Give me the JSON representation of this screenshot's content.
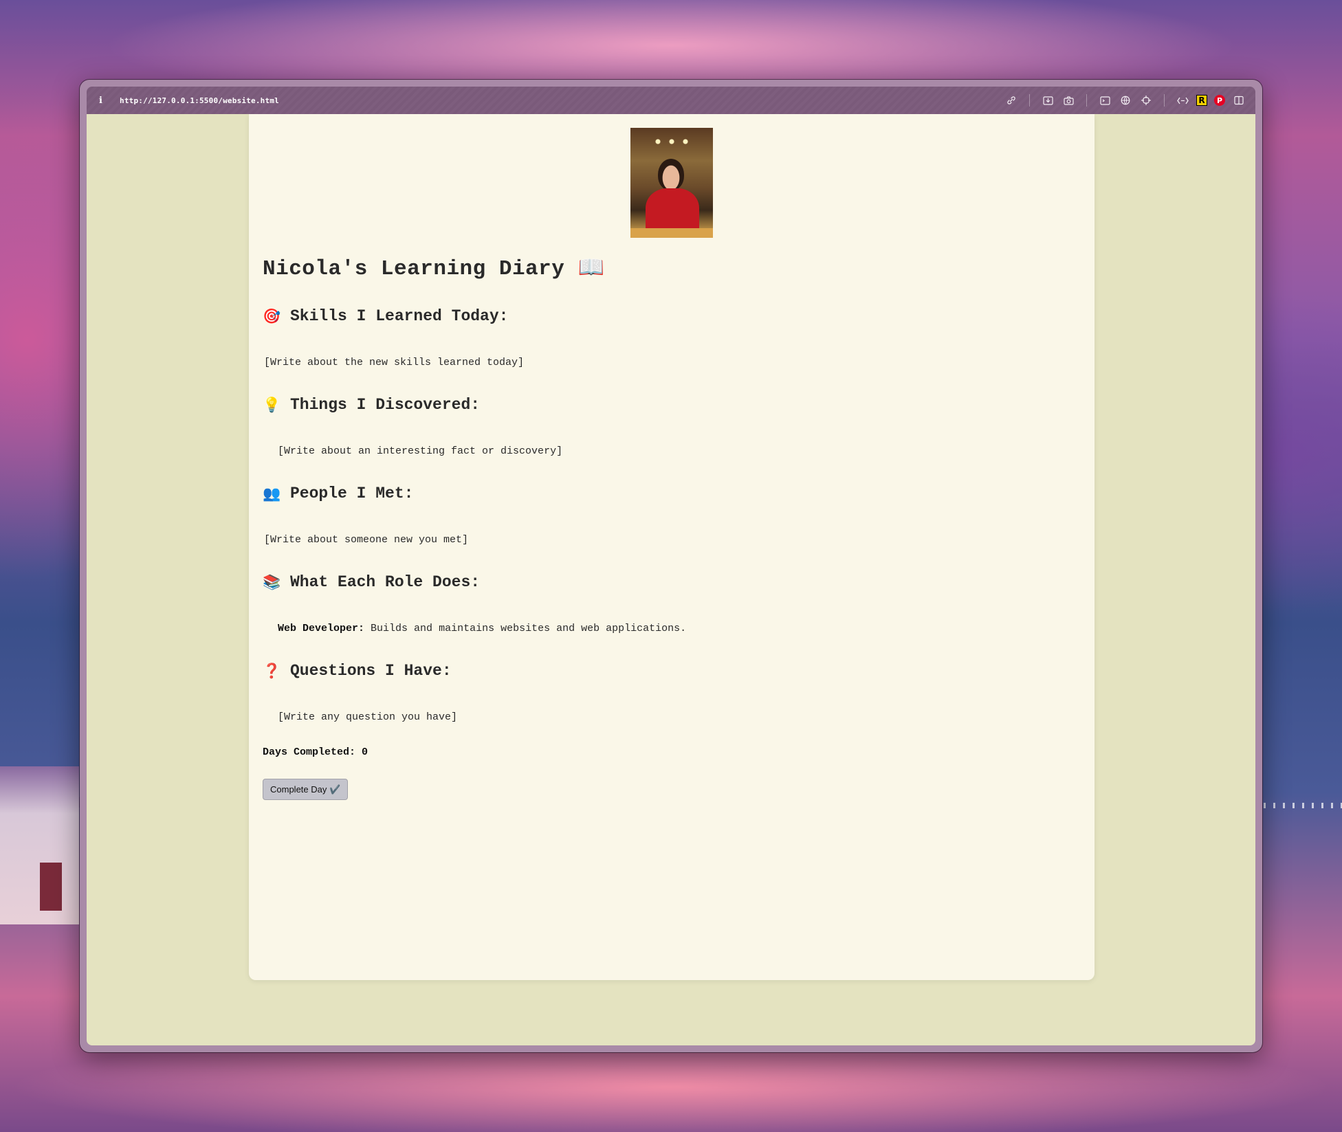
{
  "browser": {
    "url": "http://127.0.0.1:5500/website.html",
    "info_glyph": "i",
    "toolbar_icons": [
      "link-icon",
      "save-icon",
      "camera-icon",
      "terminal-icon",
      "globe-icon",
      "target-icon",
      "extensions-icon",
      "r-extension-icon",
      "pinterest-icon",
      "sidebar-icon"
    ],
    "r_extension_label": "R",
    "pinterest_label": "P"
  },
  "diary": {
    "title": "Nicola's Learning Diary 📖",
    "sections": [
      {
        "emoji": "🎯",
        "heading": "Skills I Learned Today:",
        "body": "[Write about the new skills learned today]"
      },
      {
        "emoji": "💡",
        "heading": "Things I Discovered:",
        "body": "[Write about an interesting fact or discovery]"
      },
      {
        "emoji": "👥",
        "heading": "People I Met:",
        "body": "[Write about someone new you met]"
      },
      {
        "emoji": "📚",
        "heading": "What Each Role Does:",
        "body_label": "Web Developer:",
        "body": "Builds and maintains websites and web applications."
      },
      {
        "emoji": "❓",
        "heading": "Questions I Have:",
        "body": "[Write any question you have]"
      }
    ],
    "days_completed_label": "Days Completed:",
    "days_completed_value": "0",
    "complete_button": "Complete Day ✔️"
  },
  "colors": {
    "page_background": "#faf7e8",
    "viewport_background": "#e4e3c0",
    "button_background": "#c4c4cc"
  }
}
